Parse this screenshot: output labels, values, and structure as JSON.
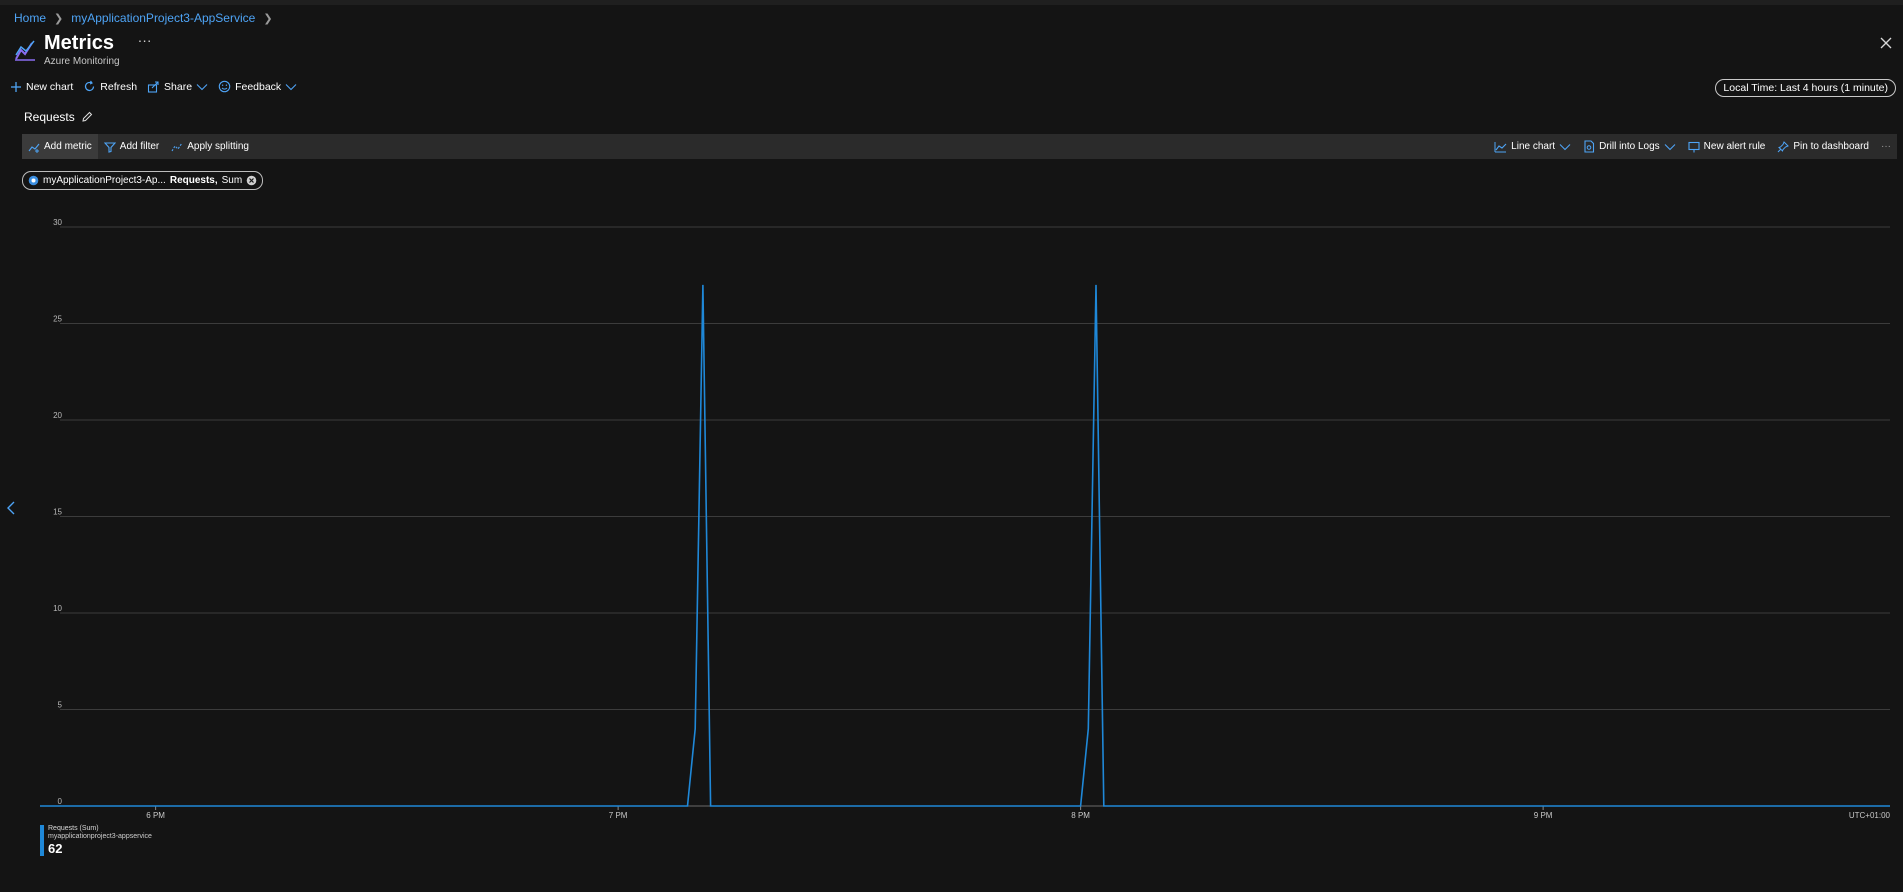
{
  "breadcrumb": {
    "home": "Home",
    "resource": "myApplicationProject3-AppService"
  },
  "header": {
    "title": "Metrics",
    "subtitle": "Azure Monitoring",
    "more": "···"
  },
  "toolbar": {
    "new_chart": "New chart",
    "refresh": "Refresh",
    "share": "Share",
    "feedback": "Feedback",
    "time_range": "Local Time: Last 4 hours (1 minute)"
  },
  "chart_panel": {
    "title": "Requests",
    "add_metric": "Add metric",
    "add_filter": "Add filter",
    "apply_splitting": "Apply splitting",
    "line_chart": "Line chart",
    "drill_into_logs": "Drill into Logs",
    "new_alert_rule": "New alert rule",
    "pin_to_dashboard": "Pin to dashboard",
    "more": "···"
  },
  "metric_pill": {
    "resource": "myApplicationProject3-Ap...",
    "metric": "Requests,",
    "aggregation": "Sum"
  },
  "legend": {
    "series": "Requests (Sum)",
    "resource": "myapplicationproject3-appservice",
    "total": "62"
  },
  "colors": {
    "accent": "#4ea4f6",
    "series": "#1f88d8",
    "background": "#141414"
  },
  "chart_data": {
    "type": "line",
    "ylim": [
      0,
      30
    ],
    "yticks": [
      "0",
      "5",
      "10",
      "15",
      "20",
      "25",
      "30"
    ],
    "xtick_labels": [
      "6 PM",
      "7 PM",
      "8 PM",
      "9 PM"
    ],
    "timezone_label": "UTC+01:00",
    "grid": true,
    "legend_position": "bottom-left",
    "series": [
      {
        "name": "Requests (Sum)",
        "points": [
          [
            "5:45 PM",
            0
          ],
          [
            "7:09 PM",
            0
          ],
          [
            "7:10 PM",
            4
          ],
          [
            "7:11 PM",
            27
          ],
          [
            "7:12 PM",
            0
          ],
          [
            "8:00 PM",
            0
          ],
          [
            "8:01 PM",
            4
          ],
          [
            "8:02 PM",
            27
          ],
          [
            "8:03 PM",
            0
          ],
          [
            "9:45 PM",
            0
          ]
        ]
      }
    ]
  }
}
